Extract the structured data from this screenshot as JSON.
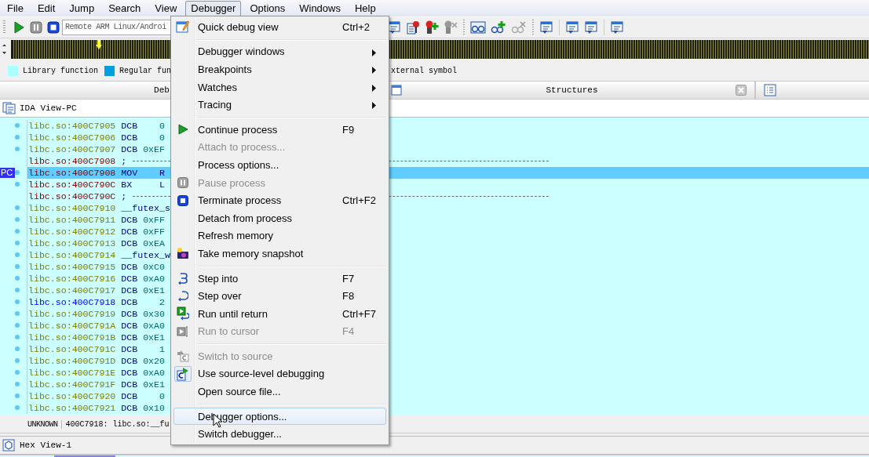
{
  "menu_bar": [
    {
      "label": "File",
      "selected": false
    },
    {
      "label": "Edit",
      "selected": false
    },
    {
      "label": "Jump",
      "selected": false
    },
    {
      "label": "Search",
      "selected": false
    },
    {
      "label": "View",
      "selected": false
    },
    {
      "label": "Debugger",
      "selected": true
    },
    {
      "label": "Options",
      "selected": false
    },
    {
      "label": "Windows",
      "selected": false
    },
    {
      "label": "Help",
      "selected": false
    }
  ],
  "toolbar": {
    "debugger_select": {
      "value": "Remote ARM Linux/Androi"
    }
  },
  "legend": [
    {
      "label": "Library function",
      "color": "#aaffff"
    },
    {
      "label": "Regular fun",
      "color": "#00a0e0"
    },
    {
      "label": "xternal symbol"
    }
  ],
  "tabs": [
    {
      "label": "Deb"
    },
    {
      "label": "Structures",
      "closable": true
    }
  ],
  "ida_view": {
    "title": "IDA View-PC",
    "pc_marker": "PC",
    "rows": [
      {
        "address": "libc.so:400C7905",
        "mnemonic": "DCB",
        "operand": "0",
        "kind": "data",
        "dot": true,
        "selected": false
      },
      {
        "address": "libc.so:400C7906",
        "mnemonic": "DCB",
        "operand": "0",
        "kind": "data",
        "dot": true,
        "selected": false
      },
      {
        "address": "libc.so:400C7907",
        "mnemonic": "DCB",
        "operand": "0xEF",
        "kind": "data",
        "dot": true,
        "selected": false
      },
      {
        "address": "libc.so:400C7908",
        "mnemonic": ";",
        "kind": "separator",
        "dot": false,
        "selected": false
      },
      {
        "address": "libc.so:400C7908",
        "mnemonic": "MOV",
        "operand": "R",
        "kind": "code",
        "dot": true,
        "selected": true,
        "pc": true
      },
      {
        "address": "libc.so:400C790C",
        "mnemonic": "BX",
        "operand": "L",
        "kind": "code",
        "dot": true,
        "selected": false
      },
      {
        "address": "libc.so:400C790C",
        "mnemonic": ";",
        "kind": "separator",
        "dot": false,
        "selected": false
      },
      {
        "address": "libc.so:400C7910",
        "mnemonic": "__futex_s",
        "kind": "function",
        "dot": true,
        "selected": false
      },
      {
        "address": "libc.so:400C7911",
        "mnemonic": "DCB",
        "operand": "0xFF",
        "kind": "data",
        "dot": true,
        "selected": false
      },
      {
        "address": "libc.so:400C7912",
        "mnemonic": "DCB",
        "operand": "0xFF",
        "kind": "data",
        "dot": true,
        "selected": false
      },
      {
        "address": "libc.so:400C7913",
        "mnemonic": "DCB",
        "operand": "0xEA",
        "kind": "data",
        "dot": true,
        "selected": false
      },
      {
        "address": "libc.so:400C7914",
        "mnemonic": "__futex_w",
        "kind": "function",
        "dot": true,
        "selected": false
      },
      {
        "address": "libc.so:400C7915",
        "mnemonic": "DCB",
        "operand": "0xC0",
        "kind": "data",
        "dot": true,
        "selected": false
      },
      {
        "address": "libc.so:400C7916",
        "mnemonic": "DCB",
        "operand": "0xA0",
        "kind": "data",
        "dot": true,
        "selected": false
      },
      {
        "address": "libc.so:400C7917",
        "mnemonic": "DCB",
        "operand": "0xE1",
        "kind": "data",
        "dot": true,
        "selected": false
      },
      {
        "address": "libc.so:400C7918",
        "mnemonic": "DCB",
        "operand": "2",
        "kind": "named",
        "dot": true,
        "selected": false
      },
      {
        "address": "libc.so:400C7919",
        "mnemonic": "DCB",
        "operand": "0x30",
        "kind": "data",
        "dot": true,
        "selected": false
      },
      {
        "address": "libc.so:400C791A",
        "mnemonic": "DCB",
        "operand": "0xA0",
        "kind": "data",
        "dot": true,
        "selected": false
      },
      {
        "address": "libc.so:400C791B",
        "mnemonic": "DCB",
        "operand": "0xE1",
        "kind": "data",
        "dot": true,
        "selected": false
      },
      {
        "address": "libc.so:400C791C",
        "mnemonic": "DCB",
        "operand": "1",
        "kind": "data",
        "dot": true,
        "selected": false
      },
      {
        "address": "libc.so:400C791D",
        "mnemonic": "DCB",
        "operand": "0x20",
        "kind": "data",
        "dot": true,
        "selected": false
      },
      {
        "address": "libc.so:400C791E",
        "mnemonic": "DCB",
        "operand": "0xA0",
        "kind": "data",
        "dot": true,
        "selected": false
      },
      {
        "address": "libc.so:400C791F",
        "mnemonic": "DCB",
        "operand": "0xE1",
        "kind": "data",
        "dot": true,
        "selected": false
      },
      {
        "address": "libc.so:400C7920",
        "mnemonic": "DCB",
        "operand": "0",
        "kind": "data",
        "dot": true,
        "selected": false
      },
      {
        "address": "libc.so:400C7921",
        "mnemonic": "DCB",
        "operand": "0x10",
        "kind": "data",
        "dot": true,
        "selected": false
      }
    ],
    "status": {
      "type": "UNKNOWN",
      "location": "400C7918: libc.so:__fu"
    }
  },
  "hex_view": {
    "title": "Hex View-1"
  },
  "debugger_menu": {
    "sections": [
      [
        {
          "label": "Quick debug view",
          "shortcut": "Ctrl+2",
          "disabled": false,
          "checked": false,
          "selected": false
        }
      ],
      [
        {
          "label": "Debugger windows",
          "submenu": true,
          "disabled": false,
          "checked": false,
          "selected": false
        },
        {
          "label": "Breakpoints",
          "submenu": true,
          "disabled": false,
          "checked": false,
          "selected": false
        },
        {
          "label": "Watches",
          "submenu": true,
          "disabled": false,
          "checked": false,
          "selected": false
        },
        {
          "label": "Tracing",
          "submenu": true,
          "disabled": false,
          "checked": false,
          "selected": false
        }
      ],
      [
        {
          "label": "Continue process",
          "shortcut": "F9",
          "disabled": false,
          "checked": false,
          "selected": false
        },
        {
          "label": "Attach to process...",
          "disabled": true,
          "checked": false,
          "selected": false
        },
        {
          "label": "Process options...",
          "disabled": false,
          "checked": false,
          "selected": false
        },
        {
          "label": "Pause process",
          "disabled": true,
          "checked": false,
          "selected": false
        },
        {
          "label": "Terminate process",
          "shortcut": "Ctrl+F2",
          "disabled": false,
          "checked": false,
          "selected": false
        },
        {
          "label": "Detach from process",
          "disabled": false,
          "checked": false,
          "selected": false
        },
        {
          "label": "Refresh memory",
          "disabled": false,
          "checked": false,
          "selected": false
        },
        {
          "label": "Take memory snapshot",
          "disabled": false,
          "checked": false,
          "selected": false
        }
      ],
      [
        {
          "label": "Step into",
          "shortcut": "F7",
          "disabled": false,
          "checked": false,
          "selected": false
        },
        {
          "label": "Step over",
          "shortcut": "F8",
          "disabled": false,
          "checked": false,
          "selected": false
        },
        {
          "label": "Run until return",
          "shortcut": "Ctrl+F7",
          "disabled": false,
          "checked": false,
          "selected": false
        },
        {
          "label": "Run to cursor",
          "shortcut": "F4",
          "disabled": true,
          "checked": false,
          "selected": false
        }
      ],
      [
        {
          "label": "Switch to source",
          "disabled": true,
          "checked": false,
          "selected": false
        },
        {
          "label": "Use source-level debugging",
          "disabled": false,
          "checked": true,
          "selected": false
        },
        {
          "label": "Open source file...",
          "disabled": false,
          "checked": false,
          "selected": false
        }
      ],
      [
        {
          "label": "Debugger options...",
          "disabled": false,
          "checked": false,
          "selected": true
        },
        {
          "label": "Switch debugger...",
          "disabled": false,
          "checked": false,
          "selected": false
        }
      ]
    ]
  }
}
